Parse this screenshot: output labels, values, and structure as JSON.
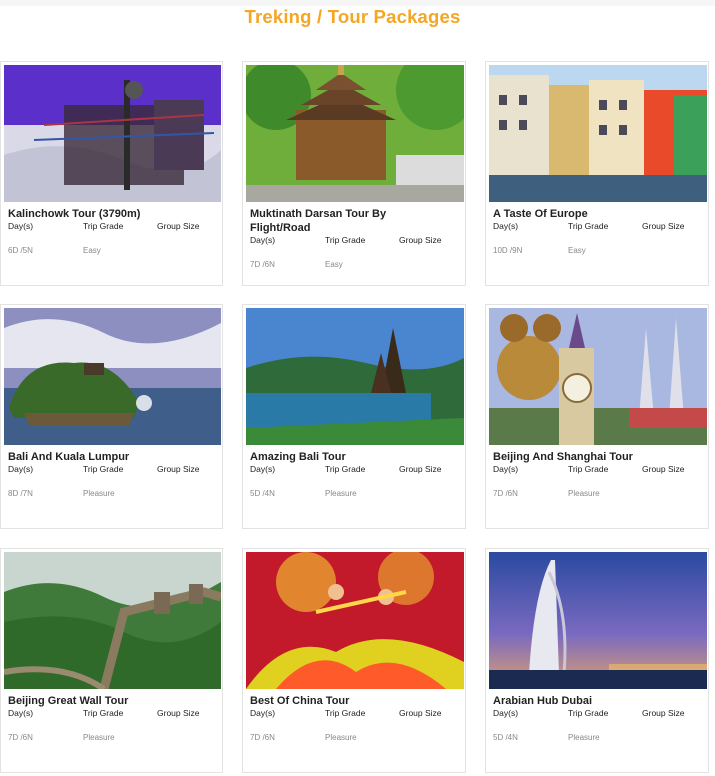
{
  "page_title": "Treking / Tour Packages",
  "labels": {
    "days": "Day(s)",
    "grade": "Trip Grade",
    "group": "Group Size"
  },
  "packages": [
    {
      "title": "Kalinchowk Tour (3790m)",
      "days": "6D /5N",
      "grade": "Easy",
      "image_subject": "snowy shrine with prayer flags"
    },
    {
      "title": "Muktinath Darsan Tour By Flight/Road",
      "days": "7D /6N",
      "grade": "Easy",
      "image_subject": "pagoda temple"
    },
    {
      "title": "A Taste Of Europe",
      "days": "10D /9N",
      "grade": "Easy",
      "image_subject": "lakeside European town"
    },
    {
      "title": "Bali And Kuala Lumpur",
      "days": "8D /7N",
      "grade": "Pleasure",
      "image_subject": "sea temple on rock"
    },
    {
      "title": "Amazing Bali Tour",
      "days": "5D /4N",
      "grade": "Pleasure",
      "image_subject": "lake temple"
    },
    {
      "title": "Beijing And Shanghai Tour",
      "days": "7D /6N",
      "grade": "Pleasure",
      "image_subject": "disney castle"
    },
    {
      "title": "Beijing Great Wall Tour",
      "days": "7D /6N",
      "grade": "Pleasure",
      "image_subject": "great wall on hills"
    },
    {
      "title": "Best Of China Tour",
      "days": "7D /6N",
      "grade": "Pleasure",
      "image_subject": "chinese dancers"
    },
    {
      "title": "Arabian Hub Dubai",
      "days": "5D /4N",
      "grade": "Pleasure",
      "image_subject": "burj al arab at dusk"
    }
  ],
  "colors": {
    "title_accent": "#f5a623"
  }
}
